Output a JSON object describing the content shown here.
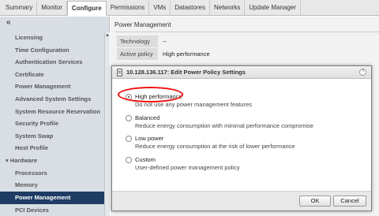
{
  "tabs": [
    "Summary",
    "Monitor",
    "Configure",
    "Permissions",
    "VMs",
    "Datastores",
    "Networks",
    "Update Manager"
  ],
  "active_tab": "Configure",
  "sidebar": {
    "collapse_glyph": "«",
    "items": [
      {
        "label": "Licensing"
      },
      {
        "label": "Time Configuration"
      },
      {
        "label": "Authentication Services"
      },
      {
        "label": "Certificate"
      },
      {
        "label": "Power Management"
      },
      {
        "label": "Advanced System Settings"
      },
      {
        "label": "System Resource Reservation"
      },
      {
        "label": "Security Profile"
      },
      {
        "label": "System Swap"
      },
      {
        "label": "Host Profile"
      },
      {
        "label": "Hardware"
      },
      {
        "label": "Processors"
      },
      {
        "label": "Memory"
      },
      {
        "label": "Power Management"
      },
      {
        "label": "PCI Devices"
      }
    ],
    "group_marker": "▾"
  },
  "main": {
    "title": "Power Management",
    "properties": [
      {
        "key": "Technology",
        "value": "--"
      },
      {
        "key": "Active policy",
        "value": "High performance"
      }
    ]
  },
  "dialog": {
    "title": "10.128.136.117: Edit Power Policy Settings",
    "help": "?",
    "options": [
      {
        "label": "High performance",
        "description": "Do not use any power management features",
        "selected": true
      },
      {
        "label": "Balanced",
        "description": "Reduce energy consumption with minimal performance compromise",
        "selected": false
      },
      {
        "label": "Low power",
        "description": "Reduce energy consumption at the risk of lower performance",
        "selected": false
      },
      {
        "label": "Custom",
        "description": "User-defined power management policy",
        "selected": false
      }
    ],
    "ok_label": "OK",
    "cancel_label": "Cancel"
  },
  "colors": {
    "selected_bg": "#1e3c64",
    "highlight": "#ee1111"
  }
}
